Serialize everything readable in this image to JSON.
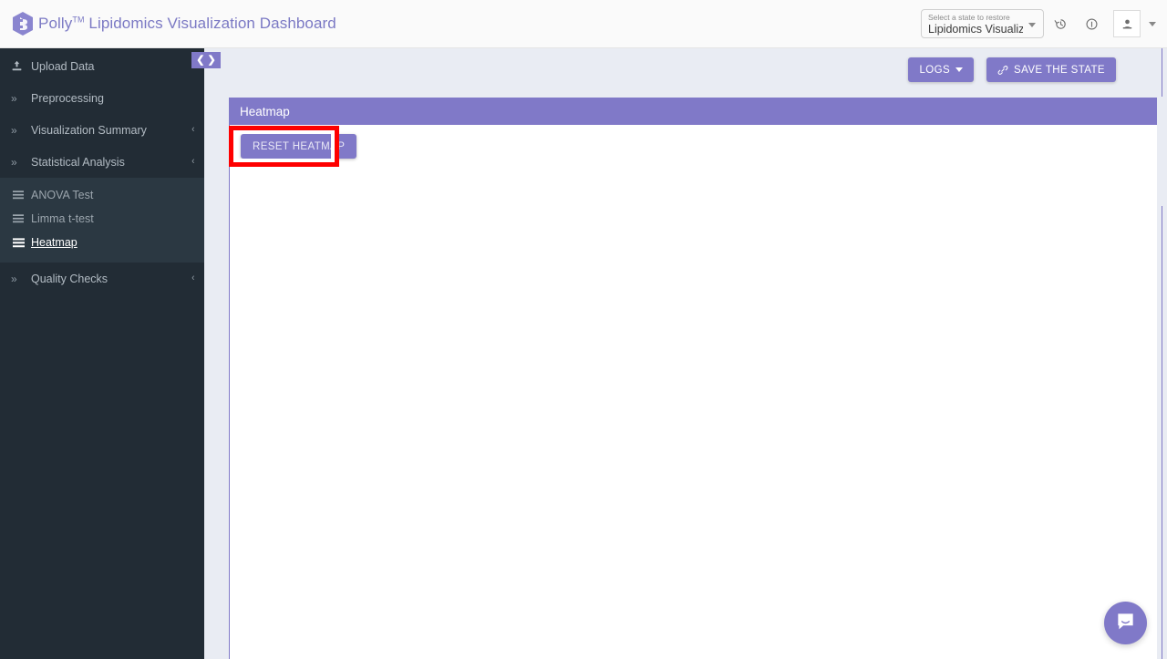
{
  "header": {
    "logo_icon": "polly-hexagon-logo",
    "brand_name": "Polly",
    "brand_tm": "TM",
    "brand_title": "Lipidomics Visualization Dashboard",
    "state_select": {
      "label": "Select a state to restore",
      "value": "Lipidomics Visualiza...",
      "caret_icon": "chevron-down-icon"
    },
    "history_icon": "history-clock-icon",
    "info_icon": "info-circle-icon",
    "avatar_icon": "person-icon",
    "avatar_caret_icon": "chevron-down-icon"
  },
  "sidebar": {
    "toggle": {
      "collapse_icon": "chevron-left-icon",
      "expand_icon": "chevron-right-icon"
    },
    "items": [
      {
        "label": "Upload Data",
        "icon": "upload-icon",
        "expandable": false,
        "chevron": ""
      },
      {
        "label": "Preprocessing",
        "icon": "chevrons-right-icon",
        "expandable": false,
        "chevron": ""
      },
      {
        "label": "Visualization Summary",
        "icon": "chevrons-right-icon",
        "expandable": true,
        "chevron": "‹"
      },
      {
        "label": "Statistical Analysis",
        "icon": "chevrons-right-icon",
        "expandable": true,
        "chevron": "‹"
      }
    ],
    "sub_items": [
      {
        "label": "ANOVA Test",
        "icon": "list-bars-icon",
        "active": false
      },
      {
        "label": "Limma t-test",
        "icon": "list-bars-icon",
        "active": false
      },
      {
        "label": "Heatmap",
        "icon": "list-bars-icon",
        "active": true
      }
    ],
    "items_after": [
      {
        "label": "Quality Checks",
        "icon": "chevrons-right-icon",
        "expandable": true,
        "chevron": "‹"
      }
    ]
  },
  "toolbar": {
    "logs_label": "LOGS",
    "logs_caret_icon": "caret-down-icon",
    "save_state_label": "SAVE THE STATE",
    "save_state_icon": "link-chain-icon"
  },
  "panel": {
    "title": "Heatmap",
    "reset_label": "RESET HEATMAP",
    "highlight_color": "#fe0000"
  },
  "chat": {
    "icon": "chat-bubble-smile-icon"
  },
  "colors": {
    "accent_purple": "#8079c8",
    "sidebar_bg": "#222c35",
    "sidebar_sub_bg": "#2b3842",
    "page_bg": "#e9ecf3",
    "topbar_bg": "#fafafa"
  }
}
